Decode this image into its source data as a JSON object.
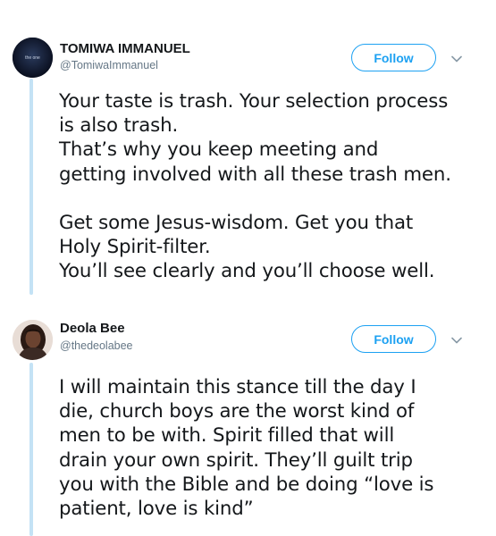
{
  "tweets": [
    {
      "name": "TOMIWA IMMANUEL",
      "handle": "@TomiwaImmanuel",
      "follow_label": "Follow",
      "avatar_text": "the one",
      "text_lines": [
        "Your taste is trash. Your selection process",
        "is also trash.",
        "That’s why you keep meeting and",
        "getting involved with all these trash men.",
        "",
        "Get some Jesus-wisdom. Get you that",
        "Holy Spirit-filter.",
        "You’ll see clearly and you’ll choose well."
      ]
    },
    {
      "name": "Deola Bee",
      "handle": "@thedeolabee",
      "follow_label": "Follow",
      "text_lines": [
        "I will maintain this stance till the day I",
        "die, church boys are the worst kind of",
        "men to be with. Spirit filled that will",
        "drain your own spirit. They’ll guilt trip",
        "you with the Bible and be doing “love is",
        "patient, love is kind”"
      ]
    }
  ],
  "colors": {
    "accent": "#1da1f2",
    "thread_line": "#c4e2f5",
    "secondary_text": "#657786",
    "text": "#14171a"
  }
}
